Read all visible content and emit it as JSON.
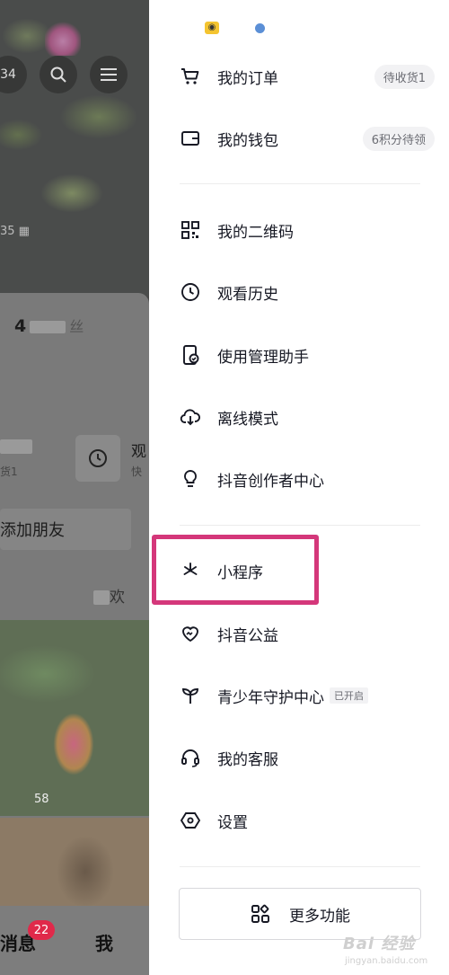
{
  "left_panel": {
    "top_count": "34",
    "count_2": "35",
    "name_prefix": "4",
    "name_suffix": "丝",
    "order_fragment": "",
    "order_sub": "货1",
    "watch_fragment": "观",
    "fast_fragment": "快",
    "add_friend": "添加朋友",
    "like_fragment": "欢",
    "thumb_count": "58",
    "tab_messages": "消息",
    "messages_badge": "22",
    "tab_me": "我"
  },
  "drawer": {
    "items": [
      {
        "label": "我的订单",
        "icon": "cart-icon",
        "pill": "待收货1"
      },
      {
        "label": "我的钱包",
        "icon": "wallet-icon",
        "pill": "6积分待领"
      },
      {
        "label": "我的二维码",
        "icon": "qrcode-icon"
      },
      {
        "label": "观看历史",
        "icon": "clock-icon"
      },
      {
        "label": "使用管理助手",
        "icon": "phone-check-icon"
      },
      {
        "label": "离线模式",
        "icon": "cloud-download-icon"
      },
      {
        "label": "抖音创作者中心",
        "icon": "lightbulb-icon"
      },
      {
        "label": "小程序",
        "icon": "mini-program-icon"
      },
      {
        "label": "抖音公益",
        "icon": "heart-icon"
      },
      {
        "label": "青少年守护中心",
        "icon": "sprout-icon",
        "tag": "已开启"
      },
      {
        "label": "我的客服",
        "icon": "headset-icon"
      },
      {
        "label": "设置",
        "icon": "hexagon-settings-icon"
      }
    ],
    "more_button": "更多功能"
  },
  "watermark": {
    "text": "Bai 经验",
    "sub": "jingyan.baidu.com"
  },
  "colors": {
    "highlight": "#d4377a",
    "badge": "#e0294a"
  }
}
